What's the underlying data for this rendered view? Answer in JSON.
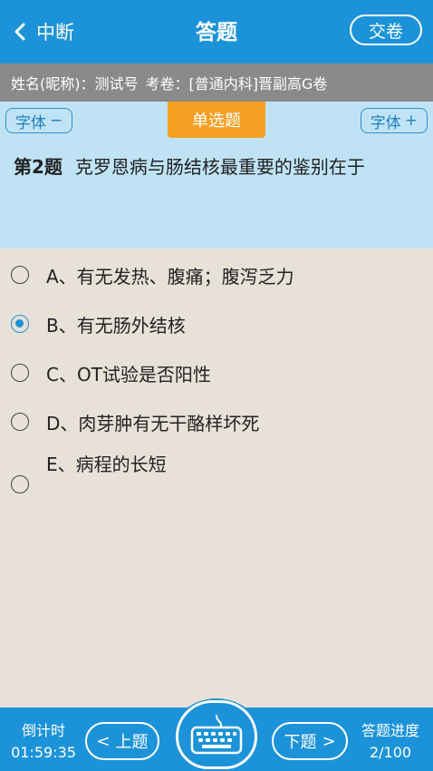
{
  "header": {
    "back_label": "中断",
    "title": "答题",
    "submit_label": "交卷"
  },
  "info_bar": {
    "name_label": "姓名(昵称)：测试号",
    "exam_label": "考卷：[普通内科]晋副高G卷"
  },
  "question_panel": {
    "font_minus_label": "字体",
    "font_minus_sign": "−",
    "font_plus_label": "字体",
    "font_plus_sign": "+",
    "question_type": "单选题",
    "question_number": "第2题",
    "question_text": "克罗恩病与肠结核最重要的鉴别在于"
  },
  "options": [
    {
      "label": "A、有无发热、腹痛；腹泻乏力",
      "selected": false
    },
    {
      "label": "B、有无肠外结核",
      "selected": true
    },
    {
      "label": "C、OT试验是否阳性",
      "selected": false
    },
    {
      "label": "D、肉芽肿有无干酪样坏死",
      "selected": false
    },
    {
      "label": "E、病程的长短",
      "selected": false
    }
  ],
  "footer": {
    "timer_label": "倒计时",
    "timer_value": "01:59:35",
    "prev_arrow": "<",
    "prev_label": "上题",
    "next_label": "下题",
    "next_arrow": ">",
    "keyboard_icon": "keyboard-icon",
    "progress_label": "答题进度",
    "progress_value": "2/100"
  },
  "colors": {
    "primary": "#1c93d8",
    "info_bar": "#8a8a8a",
    "question_bg": "#bfe3f5",
    "tag": "#f6a023",
    "body_bg": "#e8e1d8"
  }
}
